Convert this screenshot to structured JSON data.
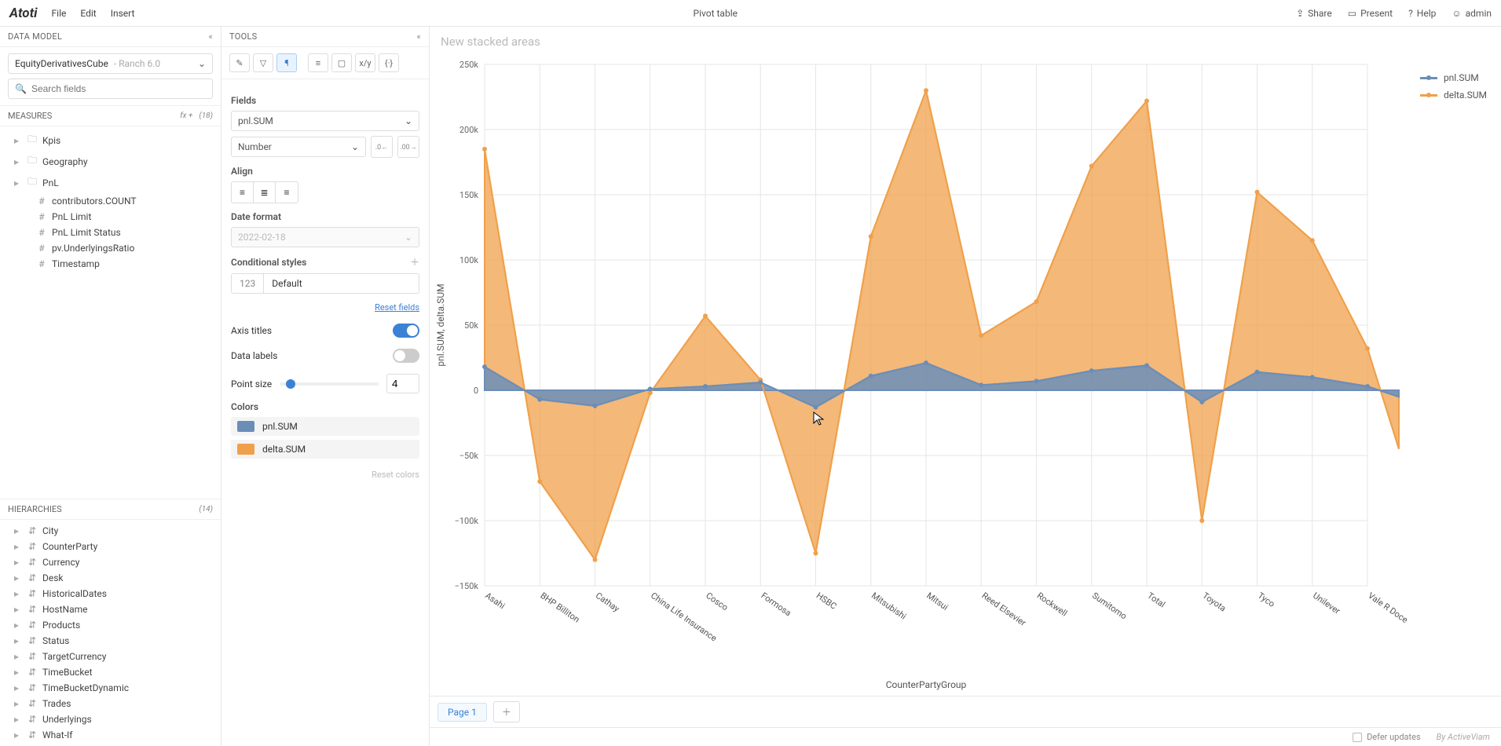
{
  "app": {
    "logo": "Atoti"
  },
  "menu": {
    "file": "File",
    "edit": "Edit",
    "insert": "Insert"
  },
  "title": "Pivot table",
  "header_tools": {
    "share": "Share",
    "present": "Present",
    "help": "Help",
    "user": "admin"
  },
  "data_model": {
    "header": "DATA MODEL",
    "cube": "EquityDerivativesCube",
    "cube_version": "- Ranch 6.0",
    "search_placeholder": "Search fields",
    "measures_header": "MEASURES",
    "measures_count": "(18)",
    "fx_label": "fx +",
    "measures": [
      {
        "icon": "folder",
        "label": "Kpis",
        "expandable": true
      },
      {
        "icon": "folder",
        "label": "Geography",
        "expandable": true
      },
      {
        "icon": "folder",
        "label": "PnL",
        "expandable": true
      },
      {
        "icon": "hash",
        "label": "contributors.COUNT",
        "indent": true
      },
      {
        "icon": "hash",
        "label": "PnL Limit",
        "indent": true
      },
      {
        "icon": "hash",
        "label": "PnL Limit Status",
        "indent": true
      },
      {
        "icon": "hash",
        "label": "pv.UnderlyingsRatio",
        "indent": true
      },
      {
        "icon": "hash",
        "label": "Timestamp",
        "indent": true
      }
    ],
    "hier_header": "HIERARCHIES",
    "hier_count": "(14)",
    "hierarchies": [
      "City",
      "CounterParty",
      "Currency",
      "Desk",
      "HistoricalDates",
      "HostName",
      "Products",
      "Status",
      "TargetCurrency",
      "TimeBucket",
      "TimeBucketDynamic",
      "Trades",
      "Underlyings",
      "What-If"
    ]
  },
  "tools": {
    "header": "TOOLS",
    "fields_label": "Fields",
    "field_value": "pnl.SUM",
    "format_value": "Number",
    "align_label": "Align",
    "date_label": "Date format",
    "date_value": "2022-02-18",
    "cond_label": "Conditional styles",
    "cond_key": "123",
    "cond_val": "Default",
    "reset_fields": "Reset fields",
    "axis_titles": "Axis titles",
    "data_labels": "Data labels",
    "point_size": "Point size",
    "point_size_val": "4",
    "colors_label": "Colors",
    "color1_label": "pnl.SUM",
    "color2_label": "delta.SUM",
    "reset_colors": "Reset colors"
  },
  "chart": {
    "title": "New stacked areas",
    "legend": {
      "s1": "pnl.SUM",
      "s2": "delta.SUM"
    },
    "tab": "Page 1"
  },
  "footer": {
    "defer": "Defer updates",
    "by": "By ActiveViam"
  },
  "colors": {
    "pnl": "#6b8eb8",
    "delta": "#f0a04b"
  },
  "chart_data": {
    "type": "area",
    "title": "New stacked areas",
    "xlabel": "CounterPartyGroup",
    "ylabel": "pnl.SUM, delta.SUM",
    "ylim": [
      -150000,
      250000
    ],
    "yticks": [
      -150000,
      -100000,
      -50000,
      0,
      50000,
      100000,
      150000,
      200000,
      250000
    ],
    "ytick_labels": [
      "−150k",
      "−100k",
      "−50k",
      "0",
      "50k",
      "100k",
      "150k",
      "200k",
      "250k"
    ],
    "categories": [
      "Asahi",
      "BHP Billiton",
      "Cathay",
      "China Life Insurance",
      "Cosco",
      "Formosa",
      "HSBC",
      "Mitsubishi",
      "Mitsui",
      "Reed Elsevier",
      "Rockwell",
      "Sumitomo",
      "Total",
      "Toyota",
      "Tyco",
      "Unilever",
      "Vale R Doce"
    ],
    "series": [
      {
        "name": "pnl.SUM",
        "color": "#6b8eb8",
        "values": [
          18000,
          -7000,
          -12000,
          1000,
          3000,
          6000,
          -13000,
          11000,
          21000,
          4000,
          7000,
          15000,
          19000,
          -9000,
          14000,
          10000,
          3000,
          -5000
        ]
      },
      {
        "name": "delta.SUM",
        "color": "#f0a04b",
        "values": [
          185000,
          -70000,
          -130000,
          -2000,
          57000,
          8000,
          -125000,
          118000,
          230000,
          42000,
          68000,
          172000,
          222000,
          -100000,
          152000,
          115000,
          32000,
          -45000
        ]
      }
    ]
  }
}
